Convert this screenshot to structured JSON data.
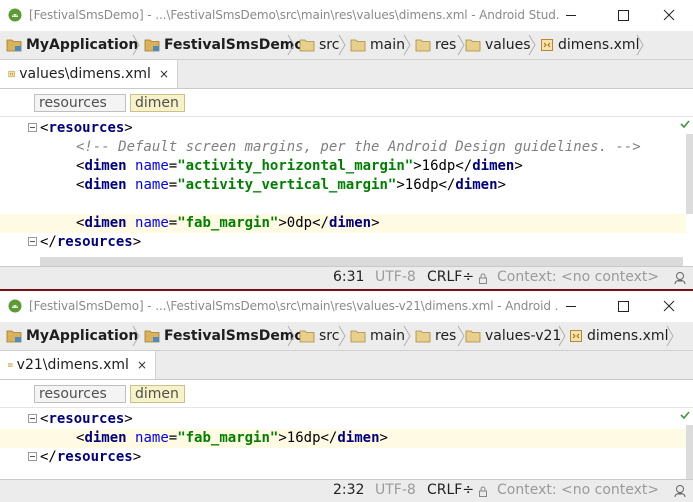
{
  "windows": [
    {
      "title": "[FestivalSmsDemo] - ...\\FestivalSmsDemo\\src\\main\\res\\values\\dimens.xml - Android Stud...",
      "breadcrumbs": [
        "MyApplication",
        "FestivalSmsDemo",
        "src",
        "main",
        "res",
        "values",
        "dimens.xml"
      ],
      "tab": {
        "label": "values\\dimens.xml",
        "close": "×"
      },
      "xml_breadcrumb": [
        "resources",
        "dimen"
      ],
      "code": [
        {
          "open": "<",
          "tag": "resources",
          "close": ">"
        },
        {
          "comment": "<!-- Default screen margins, per the Android Design guidelines. -->"
        },
        {
          "open": "<",
          "tag": "dimen",
          "attr": "name",
          "eq": "=",
          "value": "\"activity_horizontal_margin\"",
          "gt": ">",
          "text": "16dp",
          "end_open": "</",
          "end_tag": "dimen",
          "end_close": ">"
        },
        {
          "open": "<",
          "tag": "dimen",
          "attr": "name",
          "eq": "=",
          "value": "\"activity_vertical_margin\"",
          "gt": ">",
          "text": "16dp",
          "end_open": "</",
          "end_tag": "dimen",
          "end_close": ">"
        },
        {},
        {
          "open": "<",
          "tag": "dimen",
          "attr": "name",
          "eq": "=",
          "value": "\"fab_margin\"",
          "gt": ">",
          "text": "0dp",
          "end_open": "</",
          "end_tag": "dimen",
          "end_close": ">"
        },
        {
          "open": "</",
          "tag": "resources",
          "close": ">"
        }
      ],
      "status": {
        "position": "6:31",
        "encoding": "UTF-8",
        "line_sep": "CRLF÷",
        "context": "Context: <no context>"
      }
    },
    {
      "title": "[FestivalSmsDemo] - ...\\FestivalSmsDemo\\src\\main\\res\\values-v21\\dimens.xml - Android ...",
      "breadcrumbs": [
        "MyApplication",
        "FestivalSmsDemo",
        "src",
        "main",
        "res",
        "values-v21",
        "dimens.xml"
      ],
      "tab": {
        "label": "v21\\dimens.xml",
        "close": "×"
      },
      "xml_breadcrumb": [
        "resources",
        "dimen"
      ],
      "code": [
        {
          "open": "<",
          "tag": "resources",
          "close": ">"
        },
        {
          "open": "<",
          "tag": "dimen",
          "attr": "name",
          "eq": "=",
          "value": "\"fab_margin\"",
          "gt": ">",
          "text": "16dp",
          "end_open": "</",
          "end_tag": "dimen",
          "end_close": ">"
        },
        {
          "open": "</",
          "tag": "resources",
          "close": ">"
        }
      ],
      "status": {
        "position": "2:32",
        "encoding": "UTF-8",
        "line_sep": "CRLF÷",
        "context": "Context: <no context>"
      }
    }
  ],
  "icons": {
    "app": "android-studio-icon",
    "module": "module-folder-icon",
    "folder": "folder-icon",
    "xml_file": "xml-file-icon",
    "lock": "lock-icon",
    "inspector": "inspector-icon",
    "ok": "check-icon"
  },
  "colors": {
    "tag": "#000080",
    "attr": "#0000ff",
    "value": "#008000",
    "comment": "#808080",
    "caret_line": "#fffae3",
    "separator": "#7a1018"
  }
}
